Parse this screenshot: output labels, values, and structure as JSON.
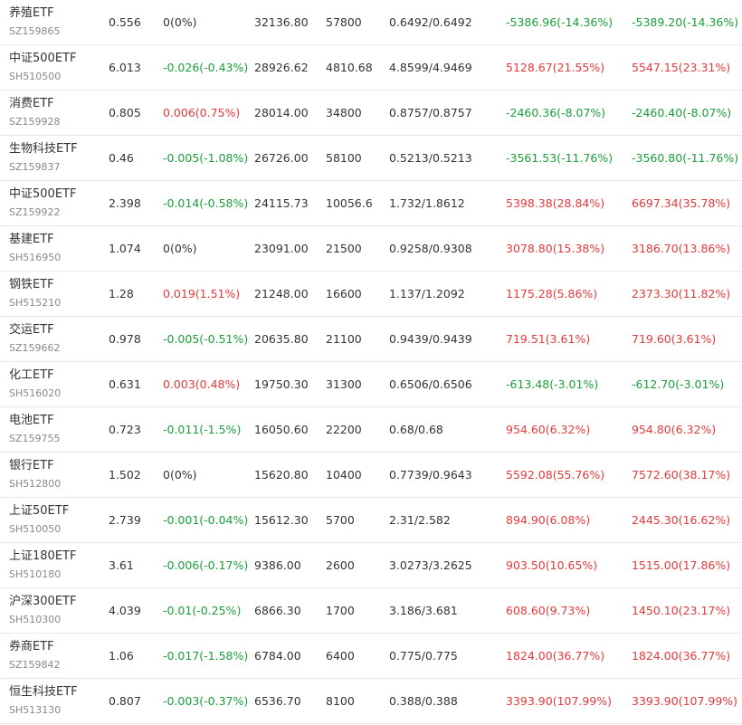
{
  "colors": {
    "up": "#e4393c",
    "down": "#1a9e3a",
    "neutral": "#333333"
  },
  "rows": [
    {
      "name": "养殖ETF",
      "code": "SZ159865",
      "price": "0.556",
      "change": "0(0%)",
      "change_dir": "neutral",
      "amount": "32136.80",
      "volume": "57800",
      "range": "0.6492/0.6492",
      "flow1": "-5386.96(-14.36%)",
      "flow1_dir": "down",
      "flow2": "-5389.20(-14.36%)",
      "flow2_dir": "down"
    },
    {
      "name": "中证500ETF",
      "code": "SH510500",
      "price": "6.013",
      "change": "-0.026(-0.43%)",
      "change_dir": "down",
      "amount": "28926.62",
      "volume": "4810.68",
      "range": "4.8599/4.9469",
      "flow1": "5128.67(21.55%)",
      "flow1_dir": "up",
      "flow2": "5547.15(23.31%)",
      "flow2_dir": "up"
    },
    {
      "name": "消费ETF",
      "code": "SZ159928",
      "price": "0.805",
      "change": "0.006(0.75%)",
      "change_dir": "up",
      "amount": "28014.00",
      "volume": "34800",
      "range": "0.8757/0.8757",
      "flow1": "-2460.36(-8.07%)",
      "flow1_dir": "down",
      "flow2": "-2460.40(-8.07%)",
      "flow2_dir": "down"
    },
    {
      "name": "生物科技ETF",
      "code": "SZ159837",
      "price": "0.46",
      "change": "-0.005(-1.08%)",
      "change_dir": "down",
      "amount": "26726.00",
      "volume": "58100",
      "range": "0.5213/0.5213",
      "flow1": "-3561.53(-11.76%)",
      "flow1_dir": "down",
      "flow2": "-3560.80(-11.76%)",
      "flow2_dir": "down"
    },
    {
      "name": "中证500ETF",
      "code": "SZ159922",
      "price": "2.398",
      "change": "-0.014(-0.58%)",
      "change_dir": "down",
      "amount": "24115.73",
      "volume": "10056.6",
      "range": "1.732/1.8612",
      "flow1": "5398.38(28.84%)",
      "flow1_dir": "up",
      "flow2": "6697.34(35.78%)",
      "flow2_dir": "up"
    },
    {
      "name": "基建ETF",
      "code": "SH516950",
      "price": "1.074",
      "change": "0(0%)",
      "change_dir": "neutral",
      "amount": "23091.00",
      "volume": "21500",
      "range": "0.9258/0.9308",
      "flow1": "3078.80(15.38%)",
      "flow1_dir": "up",
      "flow2": "3186.70(13.86%)",
      "flow2_dir": "up"
    },
    {
      "name": "钢铁ETF",
      "code": "SH515210",
      "price": "1.28",
      "change": "0.019(1.51%)",
      "change_dir": "up",
      "amount": "21248.00",
      "volume": "16600",
      "range": "1.137/1.2092",
      "flow1": "1175.28(5.86%)",
      "flow1_dir": "up",
      "flow2": "2373.30(11.82%)",
      "flow2_dir": "up"
    },
    {
      "name": "交运ETF",
      "code": "SZ159662",
      "price": "0.978",
      "change": "-0.005(-0.51%)",
      "change_dir": "down",
      "amount": "20635.80",
      "volume": "21100",
      "range": "0.9439/0.9439",
      "flow1": "719.51(3.61%)",
      "flow1_dir": "up",
      "flow2": "719.60(3.61%)",
      "flow2_dir": "up"
    },
    {
      "name": "化工ETF",
      "code": "SH516020",
      "price": "0.631",
      "change": "0.003(0.48%)",
      "change_dir": "up",
      "amount": "19750.30",
      "volume": "31300",
      "range": "0.6506/0.6506",
      "flow1": "-613.48(-3.01%)",
      "flow1_dir": "down",
      "flow2": "-612.70(-3.01%)",
      "flow2_dir": "down"
    },
    {
      "name": "电池ETF",
      "code": "SZ159755",
      "price": "0.723",
      "change": "-0.011(-1.5%)",
      "change_dir": "down",
      "amount": "16050.60",
      "volume": "22200",
      "range": "0.68/0.68",
      "flow1": "954.60(6.32%)",
      "flow1_dir": "up",
      "flow2": "954.80(6.32%)",
      "flow2_dir": "up"
    },
    {
      "name": "银行ETF",
      "code": "SH512800",
      "price": "1.502",
      "change": "0(0%)",
      "change_dir": "neutral",
      "amount": "15620.80",
      "volume": "10400",
      "range": "0.7739/0.9643",
      "flow1": "5592.08(55.76%)",
      "flow1_dir": "up",
      "flow2": "7572.60(38.17%)",
      "flow2_dir": "up"
    },
    {
      "name": "上证50ETF",
      "code": "SH510050",
      "price": "2.739",
      "change": "-0.001(-0.04%)",
      "change_dir": "down",
      "amount": "15612.30",
      "volume": "5700",
      "range": "2.31/2.582",
      "flow1": "894.90(6.08%)",
      "flow1_dir": "up",
      "flow2": "2445.30(16.62%)",
      "flow2_dir": "up"
    },
    {
      "name": "上证180ETF",
      "code": "SH510180",
      "price": "3.61",
      "change": "-0.006(-0.17%)",
      "change_dir": "down",
      "amount": "9386.00",
      "volume": "2600",
      "range": "3.0273/3.2625",
      "flow1": "903.50(10.65%)",
      "flow1_dir": "up",
      "flow2": "1515.00(17.86%)",
      "flow2_dir": "up"
    },
    {
      "name": "沪深300ETF",
      "code": "SH510300",
      "price": "4.039",
      "change": "-0.01(-0.25%)",
      "change_dir": "down",
      "amount": "6866.30",
      "volume": "1700",
      "range": "3.186/3.681",
      "flow1": "608.60(9.73%)",
      "flow1_dir": "up",
      "flow2": "1450.10(23.17%)",
      "flow2_dir": "up"
    },
    {
      "name": "券商ETF",
      "code": "SZ159842",
      "price": "1.06",
      "change": "-0.017(-1.58%)",
      "change_dir": "down",
      "amount": "6784.00",
      "volume": "6400",
      "range": "0.775/0.775",
      "flow1": "1824.00(36.77%)",
      "flow1_dir": "up",
      "flow2": "1824.00(36.77%)",
      "flow2_dir": "up"
    },
    {
      "name": "恒生科技ETF",
      "code": "SH513130",
      "price": "0.807",
      "change": "-0.003(-0.37%)",
      "change_dir": "down",
      "amount": "6536.70",
      "volume": "8100",
      "range": "0.388/0.388",
      "flow1": "3393.90(107.99%)",
      "flow1_dir": "up",
      "flow2": "3393.90(107.99%)",
      "flow2_dir": "up"
    }
  ]
}
